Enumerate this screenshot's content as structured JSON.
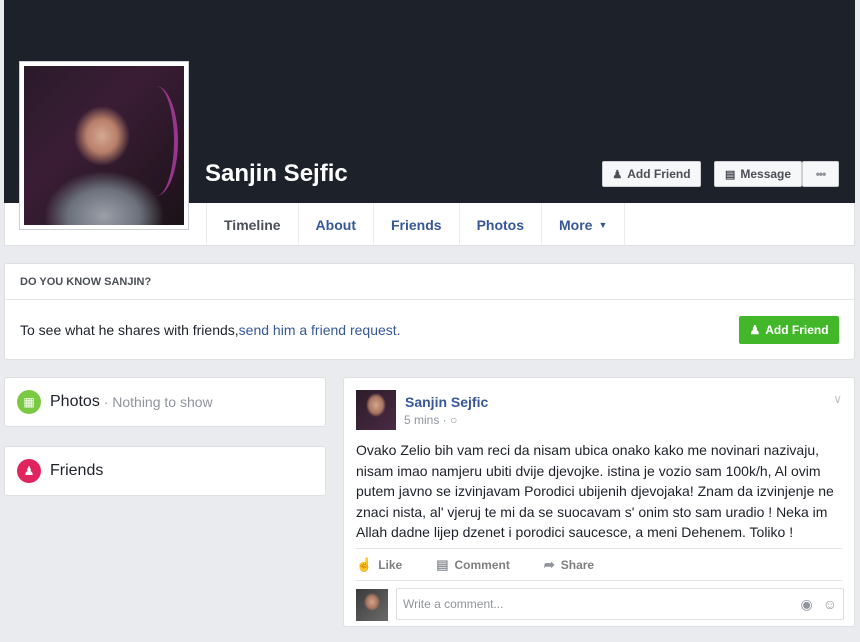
{
  "profile": {
    "name": "Sanjin Sejfic",
    "add_friend_label": "Add Friend",
    "message_label": "Message",
    "more_dots": "•••"
  },
  "tabs": [
    {
      "label": "Timeline"
    },
    {
      "label": "About"
    },
    {
      "label": "Friends"
    },
    {
      "label": "Photos"
    },
    {
      "label": "More"
    }
  ],
  "know_box": {
    "heading": "DO YOU KNOW SANJIN?",
    "text": "To see what he shares with friends, ",
    "link": "send him a friend request.",
    "button_label": "Add Friend"
  },
  "sidebar": {
    "photos_label": "Photos",
    "photos_sub": " · Nothing to show",
    "friends_label": "Friends"
  },
  "post": {
    "author": "Sanjin Sejfic",
    "time": "5 mins",
    "sep": " · ",
    "text": "Ovako Zelio bih vam reci da nisam ubica onako kako me novinari nazivaju, nisam imao namjeru ubiti dvije djevojke. istina je vozio sam 100k/h, Al ovim putem javno se izvinjavam Porodici ubijenih djevojaka! Znam da izvinjenje ne znaci nista, al' vjeruj te mi da se suocavam s' onim sto sam uradio ! Neka im Allah dadne lijep dzenet i porodici saucesce, a meni Dehenem. Toliko !",
    "like_label": "Like",
    "comment_label": "Comment",
    "share_label": "Share",
    "comment_placeholder": "Write a comment..."
  },
  "colors": {
    "cover": "#1d2129",
    "link": "#365899",
    "green": "#42b72a",
    "photos_icon": "#7ac943",
    "friends_icon": "#e0245e"
  }
}
